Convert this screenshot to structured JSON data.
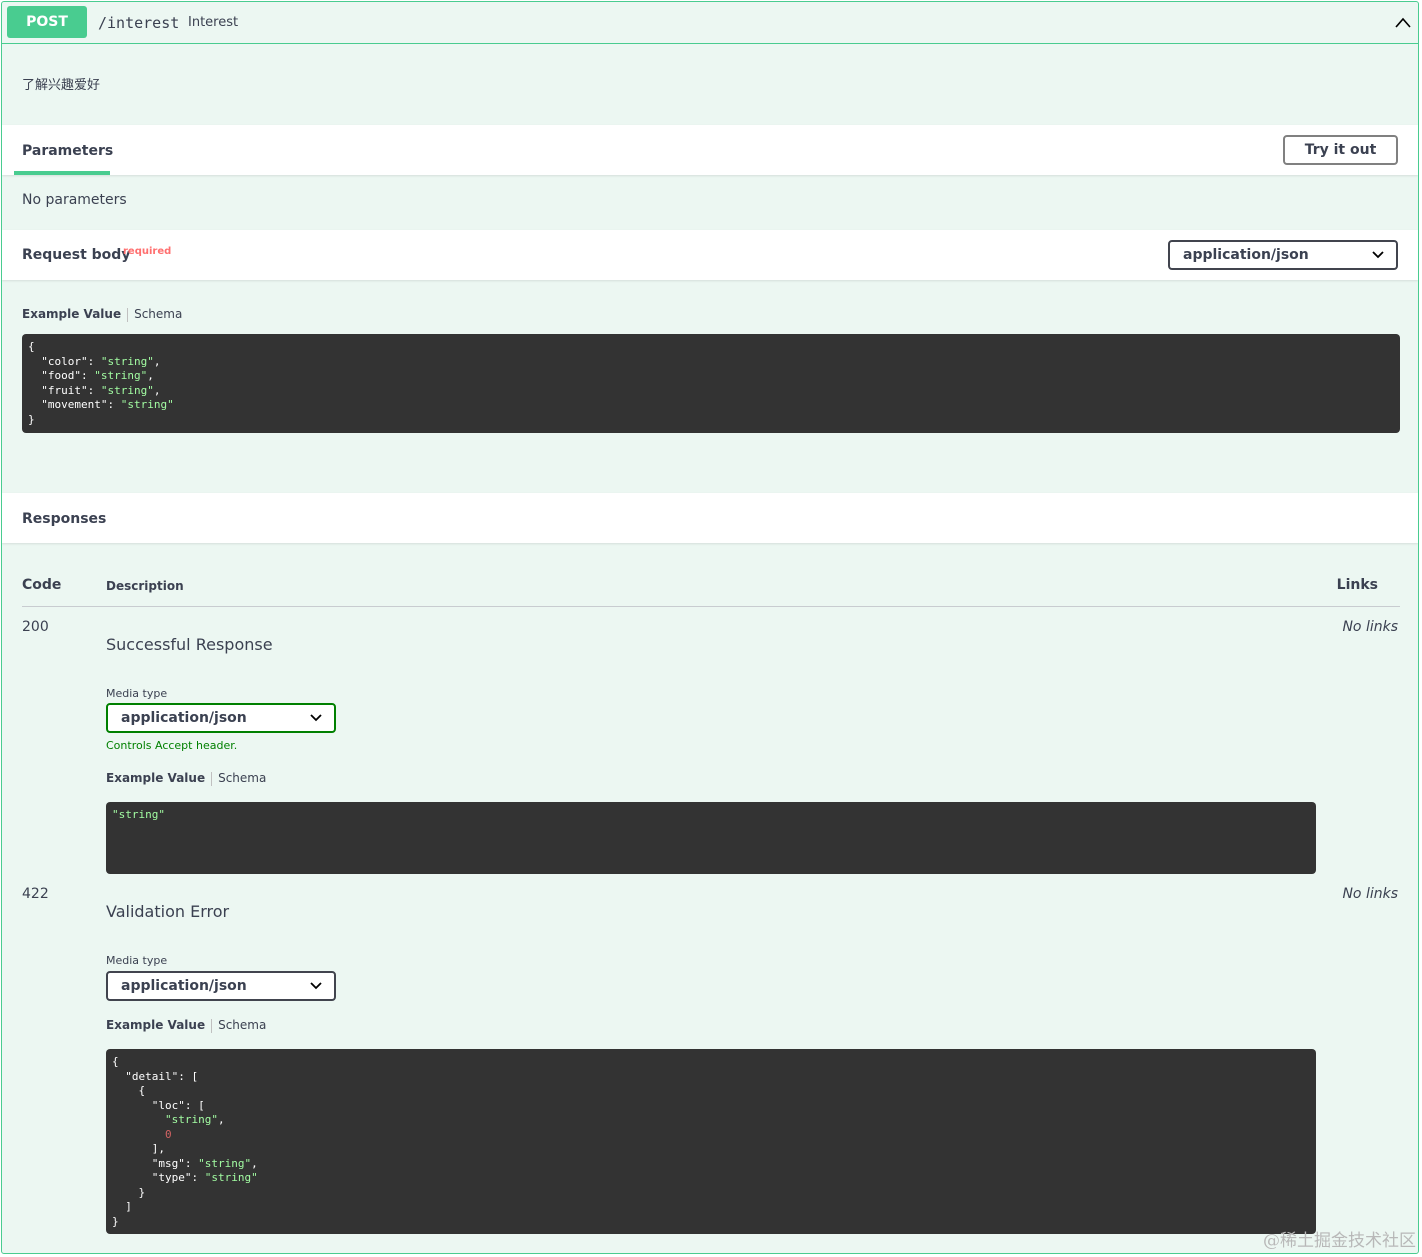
{
  "summary": {
    "method": "POST",
    "path": "/interest",
    "description": "Interest"
  },
  "description": "了解兴趣爱好",
  "parameters": {
    "title": "Parameters",
    "try_button": "Try it out",
    "none_text": "No parameters"
  },
  "request_body": {
    "title": "Request body",
    "required": "required",
    "content_type": "application/json",
    "tab_example": "Example Value",
    "tab_schema": "Schema",
    "example": {
      "open": "{",
      "close": "}",
      "lines": [
        {
          "key": "  \"color\": ",
          "value": "\"string\"",
          "end": ","
        },
        {
          "key": "  \"food\": ",
          "value": "\"string\"",
          "end": ","
        },
        {
          "key": "  \"fruit\": ",
          "value": "\"string\"",
          "end": ","
        },
        {
          "key": "  \"movement\": ",
          "value": "\"string\"",
          "end": ""
        }
      ]
    }
  },
  "responses": {
    "title": "Responses",
    "headers": {
      "code": "Code",
      "description": "Description",
      "links": "Links"
    },
    "items": [
      {
        "code": "200",
        "description": "Successful Response",
        "links": "No links",
        "media_type_label": "Media type",
        "media_type": "application/json",
        "controls_text": "Controls Accept header.",
        "tab_example": "Example Value",
        "tab_schema": "Schema",
        "example": "\"string\""
      },
      {
        "code": "422",
        "description": "Validation Error",
        "links": "No links",
        "media_type_label": "Media type",
        "media_type": "application/json",
        "tab_example": "Example Value",
        "tab_schema": "Schema",
        "example_lines": [
          {
            "text": "{"
          },
          {
            "text": "  \"detail\": ["
          },
          {
            "text": "    {"
          },
          {
            "text": "      \"loc\": ["
          },
          {
            "pre": "        ",
            "value": "\"string\"",
            "end": ","
          },
          {
            "pre": "        ",
            "num": "0"
          },
          {
            "text": "      ],"
          },
          {
            "pre": "      \"msg\": ",
            "value": "\"string\"",
            "end": ","
          },
          {
            "pre": "      \"type\": ",
            "value": "\"string\""
          },
          {
            "text": "    }"
          },
          {
            "text": "  ]"
          },
          {
            "text": "}"
          }
        ]
      }
    ]
  },
  "watermark": "@稀土掘金技术社区",
  "colors": {
    "accent": "#49cc90",
    "background": "#ecf7f2",
    "code_bg": "#333333",
    "string": "#a2fca2"
  }
}
